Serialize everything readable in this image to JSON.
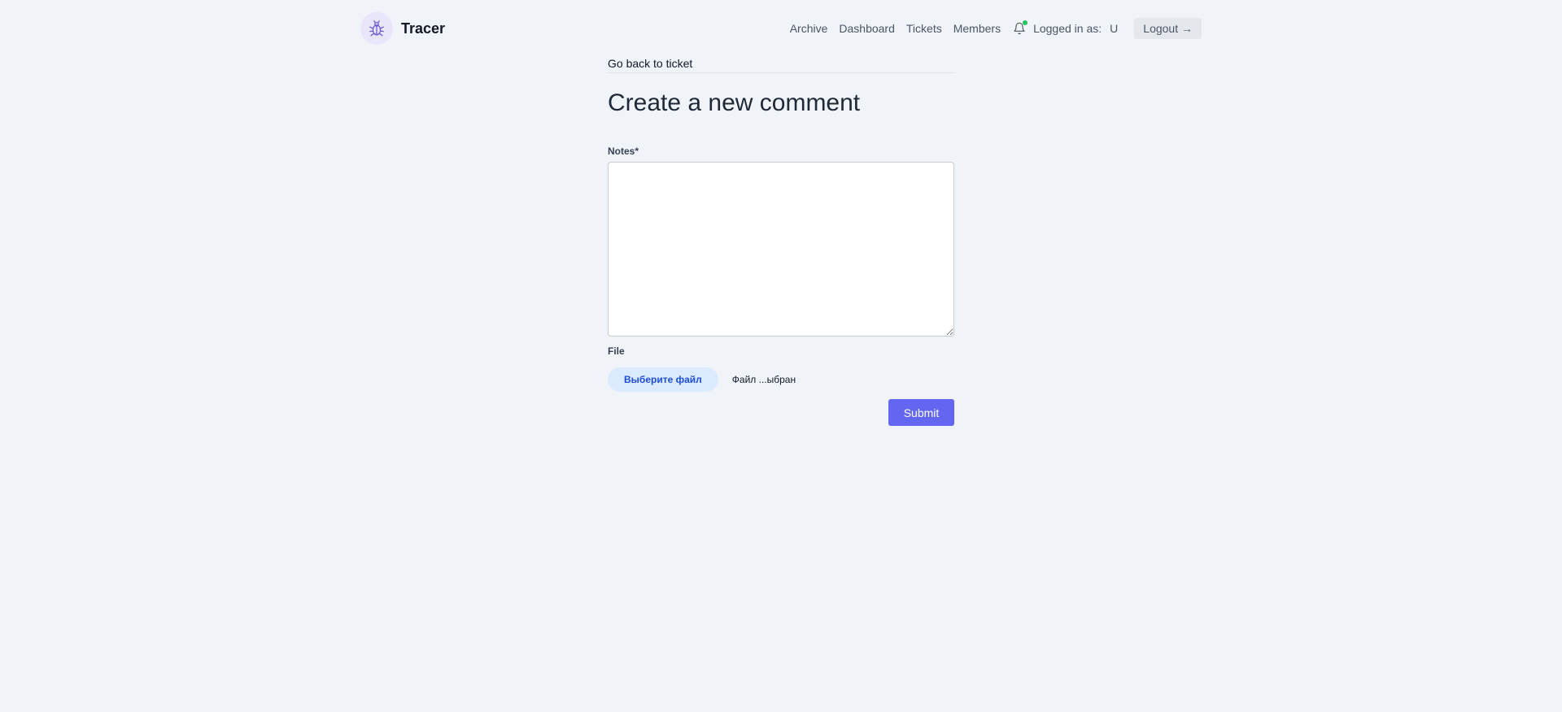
{
  "app": {
    "name": "Tracer",
    "logo_icon": "bug-icon"
  },
  "nav": {
    "links": [
      "Archive",
      "Dashboard",
      "Tickets",
      "Members"
    ],
    "notifications_icon": "bell-icon",
    "logged_in_label": "Logged in as:",
    "logged_in_user": "U",
    "logout_label": "Logout →"
  },
  "page": {
    "back_link": "Go back to ticket",
    "title": "Create a new comment"
  },
  "form": {
    "notes_label": "Notes*",
    "notes_value": "",
    "file_label": "File",
    "file_button": "Выберите файл",
    "file_status": "Файл ...ыбран",
    "submit_label": "Submit"
  },
  "colors": {
    "background": "#f0f4f9",
    "accent": "#6366f1",
    "notification_dot": "#22c55e",
    "file_button_bg": "#dbeafe",
    "file_button_text": "#1d4ed8"
  }
}
